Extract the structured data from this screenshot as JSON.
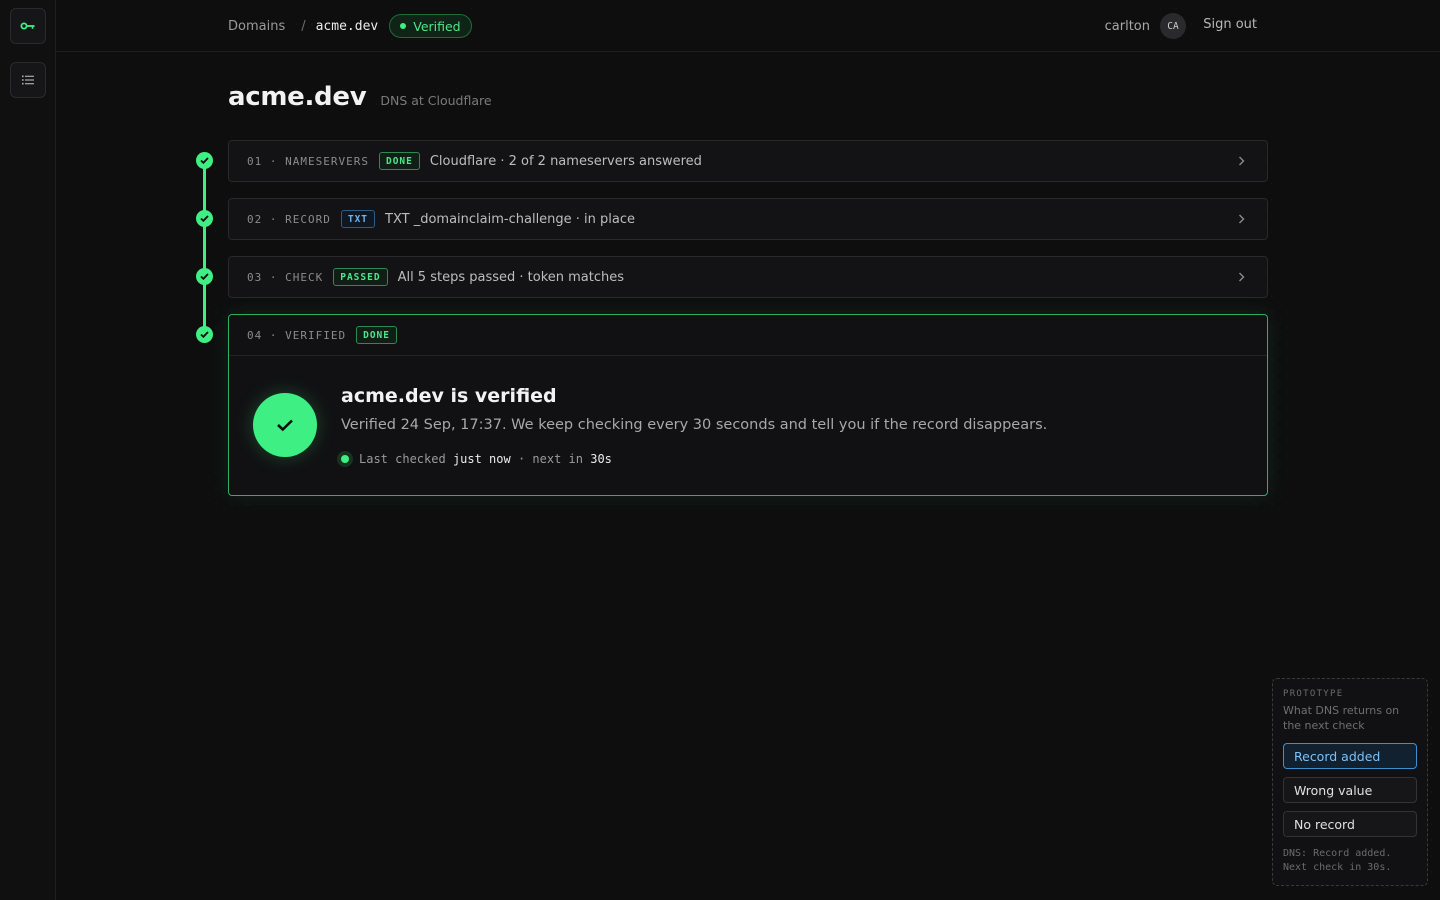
{
  "header": {
    "breadcrumb_root": "Domains",
    "breadcrumb_sep": "/",
    "breadcrumb_current": "acme.dev",
    "status_pill": "Verified",
    "username": "carlton",
    "avatar_initials": "CA",
    "sign_out": "Sign out"
  },
  "page": {
    "title": "acme.dev",
    "subtitle": "DNS at Cloudflare"
  },
  "steps": [
    {
      "meta": "01 · NAMESERVERS",
      "badge": "DONE",
      "text": "Cloudflare · 2 of 2 nameservers answered"
    },
    {
      "meta": "02 · RECORD",
      "badge": "TXT",
      "text": "TXT _domainclaim-challenge · in place"
    },
    {
      "meta": "03 · CHECK",
      "badge": "PASSED",
      "text": "All 5 steps passed · token matches"
    }
  ],
  "verified_card": {
    "meta": "04 · VERIFIED",
    "badge": "DONE",
    "title": "acme.dev is verified",
    "description": "Verified 24 Sep, 17:37. We keep checking every 30 seconds and tell you if the record disappears.",
    "status_prefix": "Last checked",
    "status_when": "just now",
    "status_mid": "· next in",
    "status_next": "30s"
  },
  "prototype": {
    "label": "PROTOTYPE",
    "description": "What DNS returns on the next check",
    "options": [
      "Record added",
      "Wrong value",
      "No record"
    ],
    "selected": "Record added",
    "status_line1": "DNS: Record added.",
    "status_line2": "Next check in 30s."
  },
  "colors": {
    "accent_green": "#3ef083",
    "accent_blue": "#6fb5ee",
    "background": "#0e0e0f"
  },
  "icons": {
    "logo": "key-icon",
    "list": "list-icon",
    "chevron": "chevron-right-icon",
    "check": "check-icon"
  }
}
